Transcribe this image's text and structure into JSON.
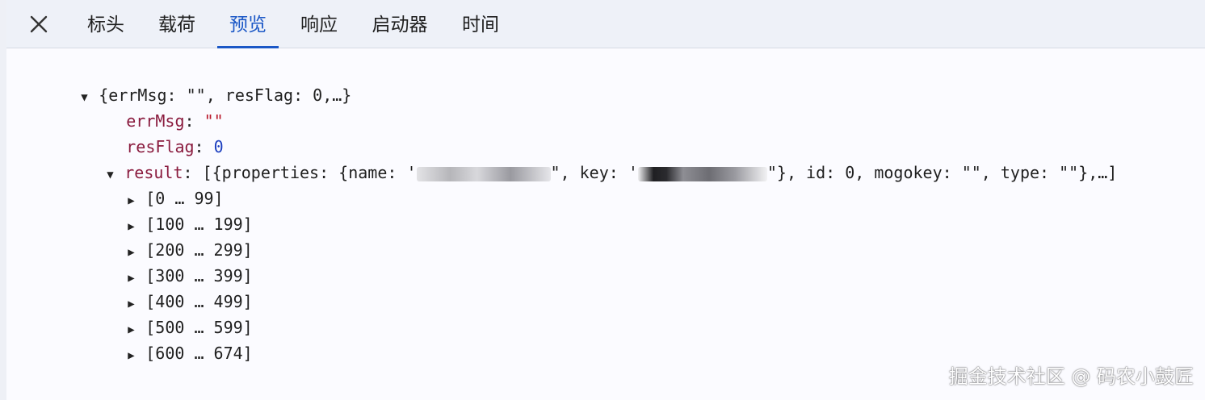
{
  "tabs": [
    {
      "label": "标头",
      "active": false
    },
    {
      "label": "载荷",
      "active": false
    },
    {
      "label": "预览",
      "active": true
    },
    {
      "label": "响应",
      "active": false
    },
    {
      "label": "启动器",
      "active": false
    },
    {
      "label": "时间",
      "active": false
    }
  ],
  "preview": {
    "root_summary": "{errMsg: \"\", resFlag: 0,…}",
    "errMsg": {
      "key": "errMsg",
      "value": "\"\""
    },
    "resFlag": {
      "key": "resFlag",
      "value": "0"
    },
    "result": {
      "key": "result",
      "summary_open": "[{properties: {name: '",
      "summary_name_end": "\", key: '",
      "summary_rest": "\"}, id: 0, mogokey: \"\", type: \"\"},…]",
      "ranges": [
        "[0 … 99]",
        "[100 … 199]",
        "[200 … 299]",
        "[300 … 399]",
        "[400 … 499]",
        "[500 … 599]",
        "[600 … 674]"
      ]
    }
  },
  "watermark": "掘金技术社区 @ 码农小鼓匠",
  "colors": {
    "accent": "#1a57c6",
    "key": "#8a1b3e",
    "string": "#b8182a",
    "number": "#1c3fbf"
  }
}
